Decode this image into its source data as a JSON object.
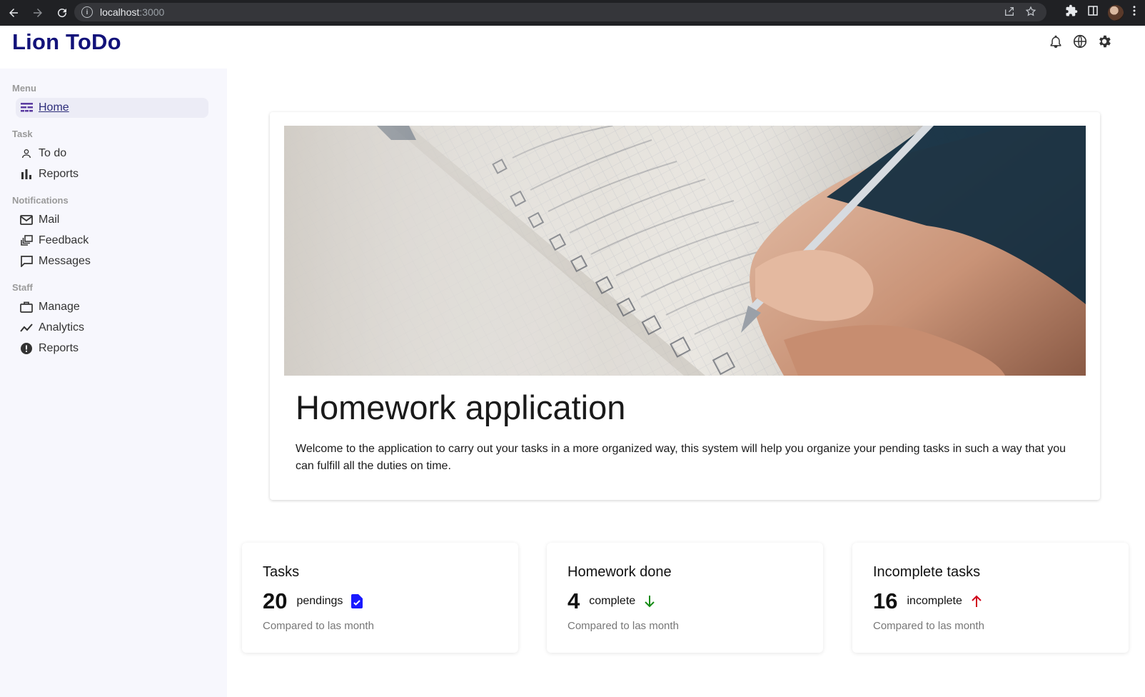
{
  "browser": {
    "url_host": "localhost",
    "url_port": ":3000"
  },
  "app": {
    "title": "Lion ToDo"
  },
  "header_icons": [
    "bell-icon",
    "globe-icon",
    "gear-icon"
  ],
  "sidebar": {
    "sections": [
      {
        "title": "Menu",
        "items": [
          {
            "label": "Home",
            "icon": "dashboard-icon",
            "active": true
          }
        ]
      },
      {
        "title": "Task",
        "items": [
          {
            "label": "To do",
            "icon": "person-icon"
          },
          {
            "label": "Reports",
            "icon": "bar-chart-icon"
          }
        ]
      },
      {
        "title": "Notifications",
        "items": [
          {
            "label": "Mail",
            "icon": "mail-icon"
          },
          {
            "label": "Feedback",
            "icon": "dynamic-feed-icon"
          },
          {
            "label": "Messages",
            "icon": "chat-bubble-icon"
          }
        ]
      },
      {
        "title": "Staff",
        "items": [
          {
            "label": "Manage",
            "icon": "briefcase-icon"
          },
          {
            "label": "Analytics",
            "icon": "trending-line-icon"
          },
          {
            "label": "Reports",
            "icon": "alert-circle-icon"
          }
        ]
      }
    ]
  },
  "hero": {
    "title": "Homework application",
    "text": "Welcome to the application to carry out your tasks in a more organized way, this system will help you organize your pending tasks in such a way that you can fulfill all the duties on time."
  },
  "stats": [
    {
      "title": "Tasks",
      "value": "20",
      "unit": "pendings",
      "icon": "task-document-icon",
      "icon_color": "#1a1aff",
      "subtitle": "Compared to las month"
    },
    {
      "title": "Homework done",
      "value": "4",
      "unit": "complete",
      "icon": "arrow-down-icon",
      "icon_color": "#138a13",
      "subtitle": "Compared to las month"
    },
    {
      "title": "Incomplete tasks",
      "value": "16",
      "unit": "incomplete",
      "icon": "arrow-up-icon",
      "icon_color": "#d0021b",
      "subtitle": "Compared to las month"
    }
  ]
}
